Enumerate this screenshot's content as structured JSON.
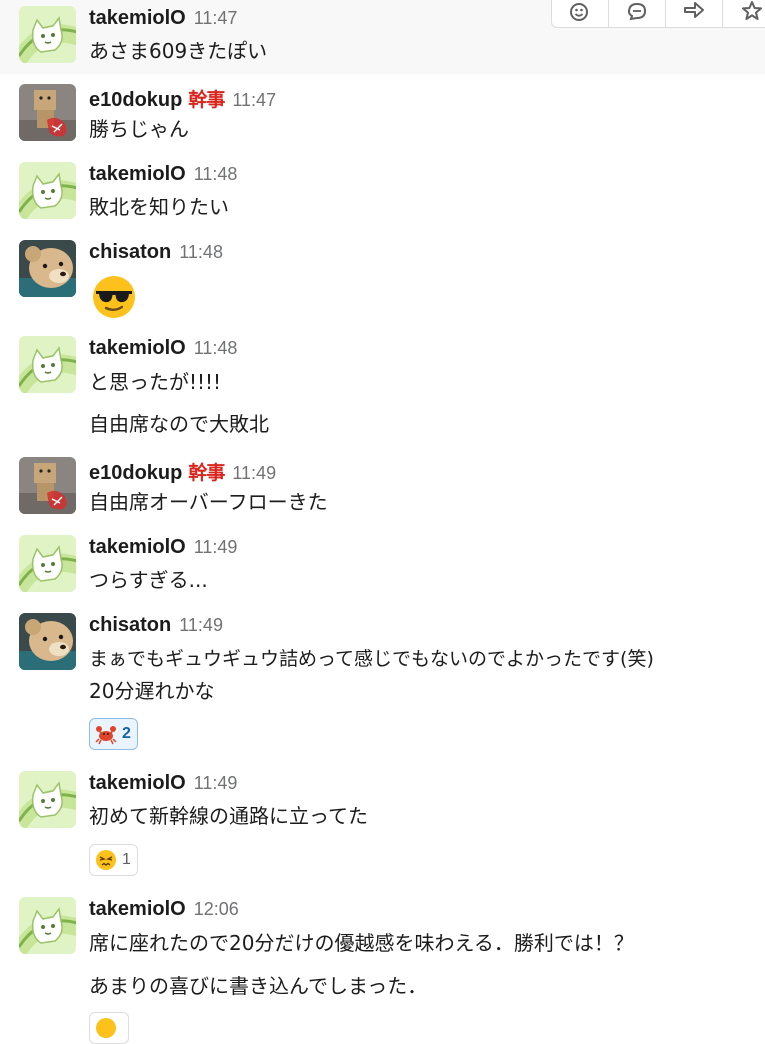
{
  "colors": {
    "username": "#1d1c1d",
    "timestamp": "#717274",
    "badge": "#d9251c",
    "hover_background": "#f8f8f8",
    "reaction_active_border": "#8dbde6",
    "reaction_active_count": "#1264a3"
  },
  "toolbar": {
    "actions": [
      {
        "icon": "add-reaction-icon"
      },
      {
        "icon": "start-thread-icon"
      },
      {
        "icon": "share-message-icon"
      },
      {
        "icon": "star-icon"
      }
    ]
  },
  "messages": [
    {
      "user": "takemiolO",
      "time": "11:47",
      "avatar": "cat-avatar",
      "lines": [
        "あさま609きたぽい"
      ]
    },
    {
      "user": "e10dokup",
      "badge": "幹事",
      "time": "11:47",
      "avatar": "box-robot-avatar",
      "lines": [
        "勝ちじゃん"
      ]
    },
    {
      "user": "takemiolO",
      "time": "11:48",
      "avatar": "cat-avatar",
      "lines": [
        "敗北を知りたい"
      ]
    },
    {
      "user": "chisaton",
      "time": "11:48",
      "avatar": "bear-avatar",
      "emoji": "sunglasses-emoji"
    },
    {
      "user": "takemiolO",
      "time": "11:48",
      "avatar": "cat-avatar",
      "lines": [
        "と思ったが!!!!",
        "自由席なので大敗北"
      ]
    },
    {
      "user": "e10dokup",
      "badge": "幹事",
      "time": "11:49",
      "avatar": "box-robot-avatar",
      "lines": [
        "自由席オーバーフローきた"
      ]
    },
    {
      "user": "takemiolO",
      "time": "11:49",
      "avatar": "cat-avatar",
      "lines": [
        "つらすぎる..."
      ]
    },
    {
      "user": "chisaton",
      "time": "11:49",
      "avatar": "bear-avatar",
      "lines": [
        "まぁでもギュウギュウ詰めって感じでもないのでよかったです(笑)",
        "20分遅れかな"
      ],
      "reaction": {
        "emoji": "crab-emoji",
        "count": "2"
      }
    },
    {
      "user": "takemiolO",
      "time": "11:49",
      "avatar": "cat-avatar",
      "lines": [
        "初めて新幹線の通路に立ってた"
      ],
      "reaction": {
        "emoji": "persevere-emoji",
        "count": "1"
      }
    },
    {
      "user": "takemiolO",
      "time": "12:06",
      "avatar": "cat-avatar",
      "lines": [
        "席に座れたので20分だけの優越感を味わえる．勝利では！？",
        "あまりの喜びに書き込んでしまった．"
      ],
      "reaction": {
        "emoji": "face-emoji",
        "count": ""
      }
    }
  ]
}
